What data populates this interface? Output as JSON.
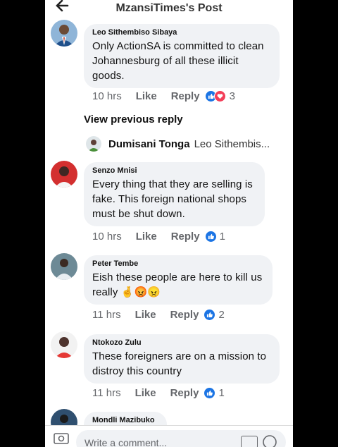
{
  "header": {
    "title": "MzansiTimes's Post",
    "back_icon": "arrow-left-icon"
  },
  "comments": [
    {
      "name": "Leo Sithembiso Sibaya",
      "text": "Only ActionSA is committed to clean Johannesburg of all these illicit goods.",
      "time": "10 hrs",
      "like": "Like",
      "reply": "Reply",
      "reaction_count": "3",
      "reactions": [
        "like",
        "love"
      ]
    },
    {
      "name": "Senzo Mnisi",
      "text": "Every thing that they are selling is fake. This foreign national shops must be shut down.",
      "time": "10 hrs",
      "like": "Like",
      "reply": "Reply",
      "reaction_count": "1",
      "reactions": [
        "like"
      ]
    },
    {
      "name": "Peter Tembe",
      "text": "Eish these people are here to kill us really",
      "emojis": "🤞😡😠",
      "time": "11 hrs",
      "like": "Like",
      "reply": "Reply",
      "reaction_count": "2",
      "reactions": [
        "like"
      ]
    },
    {
      "name": "Ntokozo Zulu",
      "text": "These foreigners are on a mission to distroy this country",
      "time": "11 hrs",
      "like": "Like",
      "reply": "Reply",
      "reaction_count": "1",
      "reactions": [
        "like"
      ]
    },
    {
      "name": "Mondli Mazibuko"
    }
  ],
  "view_previous": "View previous reply",
  "reply_preview": {
    "name": "Dumisani Tonga",
    "text": "Leo Sithembis..."
  },
  "composer": {
    "placeholder": "Write a comment..."
  },
  "colors": {
    "like_blue": "#1b74e4",
    "love_red": "#f33e58",
    "bubble": "#f0f2f5"
  }
}
